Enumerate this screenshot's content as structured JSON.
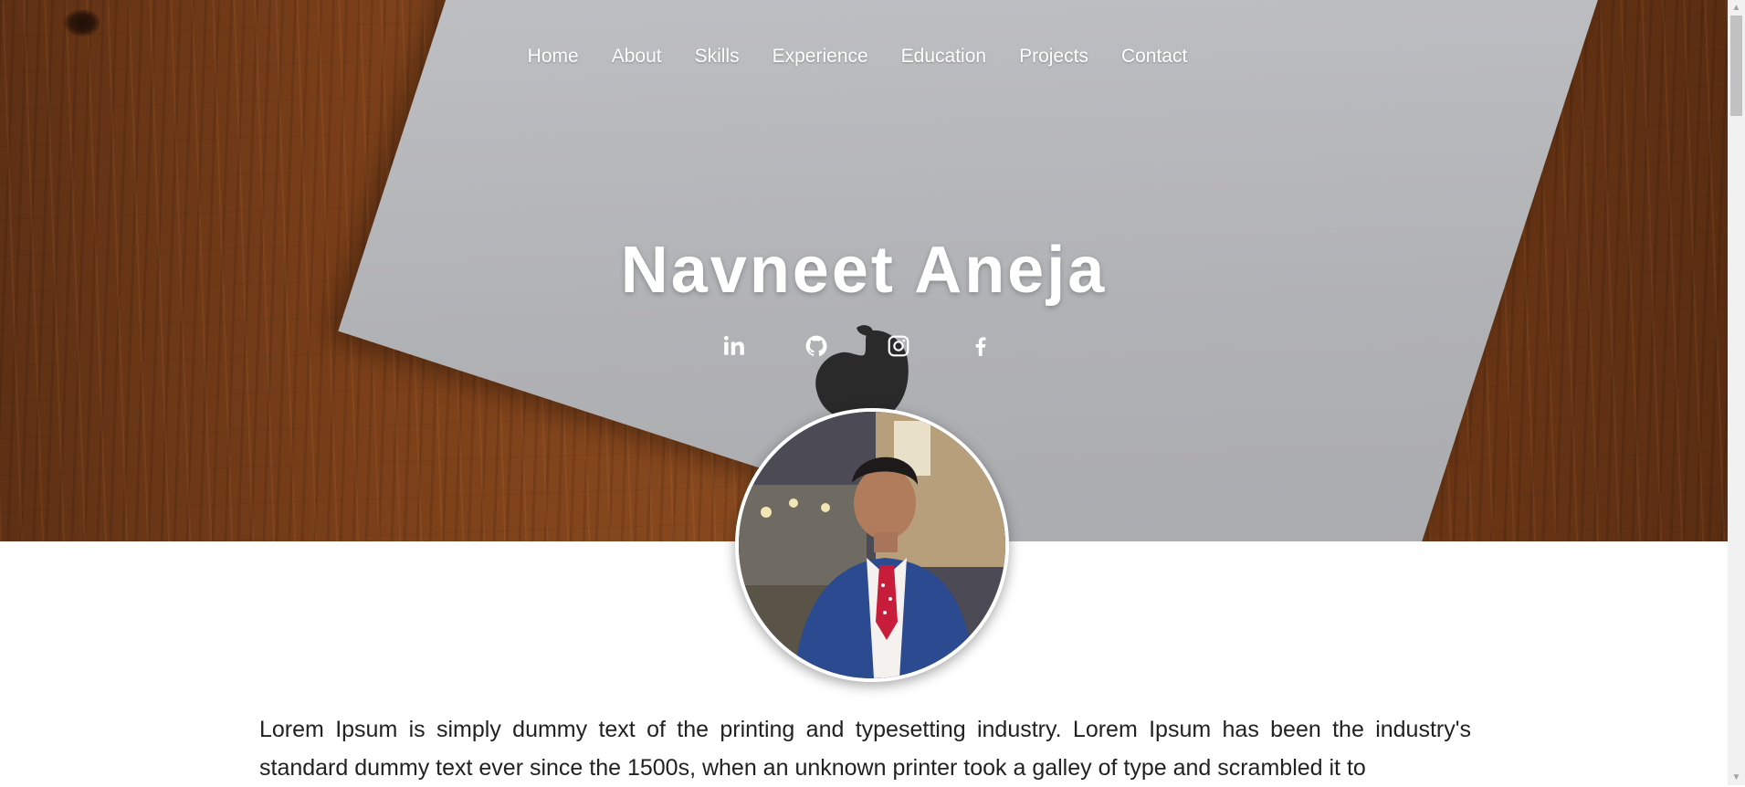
{
  "nav": {
    "items": [
      {
        "label": "Home"
      },
      {
        "label": "About"
      },
      {
        "label": "Skills"
      },
      {
        "label": "Experience"
      },
      {
        "label": "Education"
      },
      {
        "label": "Projects"
      },
      {
        "label": "Contact"
      }
    ]
  },
  "hero": {
    "name": "Navneet Aneja",
    "social": [
      {
        "icon": "linkedin-icon"
      },
      {
        "icon": "github-icon"
      },
      {
        "icon": "instagram-icon"
      },
      {
        "icon": "facebook-icon"
      }
    ]
  },
  "about": {
    "text": "Lorem Ipsum is simply dummy text of the printing and typesetting industry. Lorem Ipsum has been the industry's standard dummy text ever since the 1500s, when an unknown printer took a galley of type and scrambled it to"
  },
  "colors": {
    "nav_text": "#ffffff",
    "body_text": "#222222"
  }
}
